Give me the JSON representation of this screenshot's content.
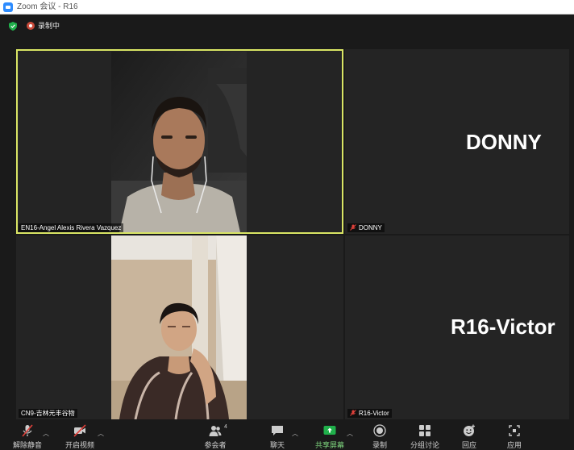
{
  "window": {
    "title": "Zoom 会议 - R16"
  },
  "topbar": {
    "recording_label": "录制中"
  },
  "tiles": [
    {
      "id": "en16",
      "name": "EN16-Angel Alexis Rivera Vazquez",
      "active": true
    },
    {
      "id": "donny",
      "name": "DONNY",
      "big_name": "DONNY",
      "muted": true
    },
    {
      "id": "cn9",
      "name": "CN9-吉林元丰谷物"
    },
    {
      "id": "r16",
      "name": "R16-Victor",
      "big_name": "R16-Victor",
      "muted": true
    }
  ],
  "toolbar": {
    "unmute": "解除静音",
    "start_video": "开启视频",
    "participants": "参会者",
    "participants_count": "4",
    "chat": "聊天",
    "share_screen": "共享屏幕",
    "record": "录制",
    "breakout": "分组讨论",
    "reactions": "回应",
    "apps": "应用"
  },
  "colors": {
    "active_border": "#d9e564",
    "share_green": "#20b04b",
    "muted_red": "#e0413b"
  }
}
